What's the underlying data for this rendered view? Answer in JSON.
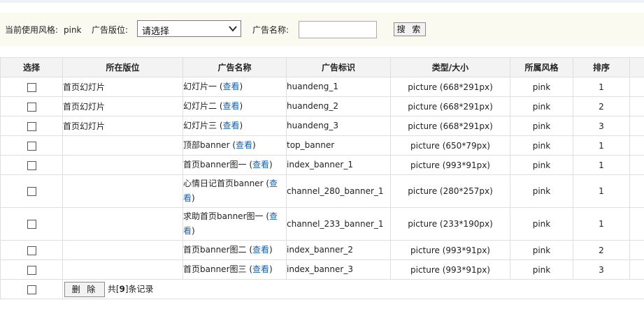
{
  "filter": {
    "style_label": "当前使用风格:",
    "style_value": "pink",
    "position_label": "广告版位:",
    "position_select": "请选择",
    "name_label": "广告名称:",
    "name_value": "",
    "search_button": "搜 索"
  },
  "table": {
    "headers": [
      "选择",
      "所在版位",
      "广告名称",
      "广告标识",
      "类型/大小",
      "所属风格",
      "排序"
    ],
    "view_link": "查看",
    "rows": [
      {
        "position": "首页幻灯片",
        "name": "幻灯片一",
        "mark": "huandeng_1",
        "type": "picture (668*291px)",
        "style": "pink",
        "order": "1"
      },
      {
        "position": "首页幻灯片",
        "name": "幻灯片二",
        "mark": "huandeng_2",
        "type": "picture (668*291px)",
        "style": "pink",
        "order": "2"
      },
      {
        "position": "首页幻灯片",
        "name": "幻灯片三",
        "mark": "huandeng_3",
        "type": "picture (668*291px)",
        "style": "pink",
        "order": "3"
      },
      {
        "position": "",
        "name": "顶部banner",
        "mark": "top_banner",
        "type": "picture (650*79px)",
        "style": "pink",
        "order": "1"
      },
      {
        "position": "",
        "name": "首页banner图一",
        "mark": "index_banner_1",
        "type": "picture (993*91px)",
        "style": "pink",
        "order": "1"
      },
      {
        "position": "",
        "name": "心情日记首页banner",
        "mark": "channel_280_banner_1",
        "type": "picture (280*257px)",
        "style": "pink",
        "order": "1"
      },
      {
        "position": "",
        "name": "求助首页banner图一",
        "mark": "channel_233_banner_1",
        "type": "picture (233*190px)",
        "style": "pink",
        "order": "1"
      },
      {
        "position": "",
        "name": "首页banner图二",
        "mark": "index_banner_2",
        "type": "picture (993*91px)",
        "style": "pink",
        "order": "2"
      },
      {
        "position": "",
        "name": "首页banner图三",
        "mark": "index_banner_3",
        "type": "picture (993*91px)",
        "style": "pink",
        "order": "3"
      }
    ]
  },
  "footer": {
    "delete_button": "删 除",
    "count_prefix": "共[",
    "count_value": "9",
    "count_suffix": "]条记录"
  }
}
